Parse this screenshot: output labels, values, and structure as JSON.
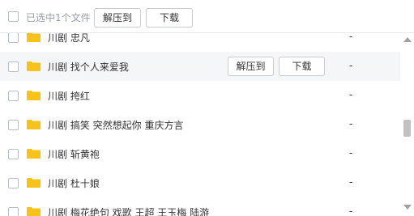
{
  "toolbar": {
    "selected_text": "已选中1个文件",
    "extract_label": "解压到",
    "download_label": "下载"
  },
  "colors": {
    "folder": "#f7c31b",
    "hover_row": "#f5f6f8",
    "border": "#c9ccd3"
  },
  "rows": [
    {
      "name": "川剧 忠凡",
      "size": "-"
    },
    {
      "name": "川剧 找个人来爱我",
      "size": "-",
      "extract_label": "解压到",
      "download_label": "下载"
    },
    {
      "name": "川剧 挎红",
      "size": "-"
    },
    {
      "name": "川剧 搞笑 突然想起你 重庆方言",
      "size": "-"
    },
    {
      "name": "川剧 斩黄袍",
      "size": "-"
    },
    {
      "name": "川剧 杜十娘",
      "size": "-"
    },
    {
      "name": "川剧 梅花绝句 戏歌 王超 王玉梅 陆游",
      "size": "-"
    }
  ],
  "icons": {
    "row_icon": "folder-icon",
    "scroll_up": "arrow-up-icon",
    "scroll_down": "arrow-down-icon"
  }
}
